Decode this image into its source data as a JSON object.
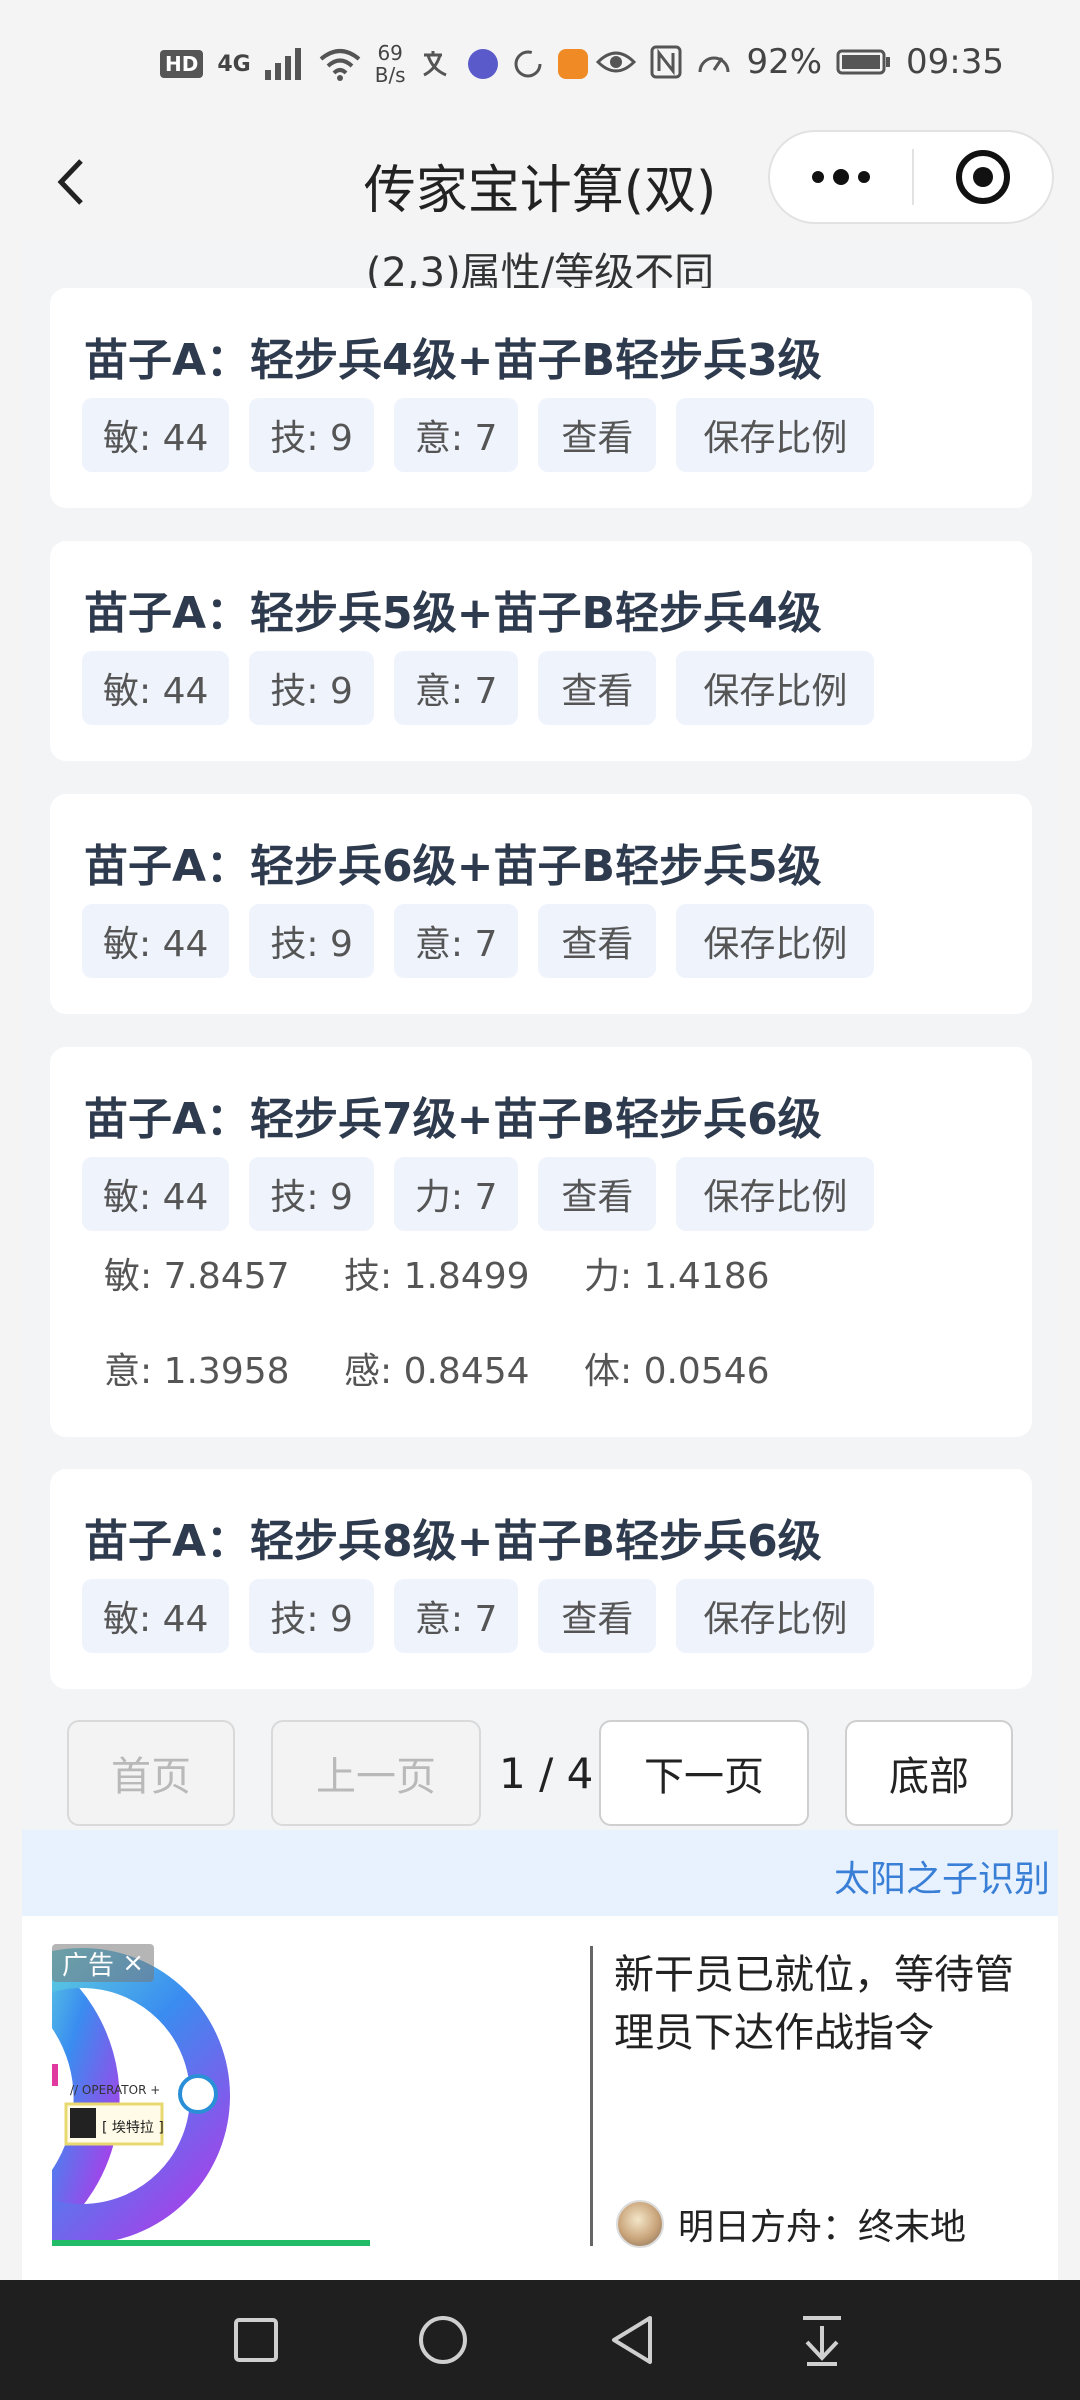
{
  "status_bar": {
    "hd": "HD",
    "network": "4G",
    "speed_value": "69",
    "speed_unit": "B/s",
    "battery": "92%",
    "time": "09:35"
  },
  "header": {
    "title": "传家宝计算(双)"
  },
  "subtitle": "(2,3)属性/等级不同",
  "cards": [
    {
      "title": "苗子A：轻步兵4级+苗子B轻步兵3级",
      "chips": [
        "敏: 44",
        "技: 9",
        "意: 7"
      ],
      "view_label": "查看",
      "save_label": "保存比例"
    },
    {
      "title": "苗子A：轻步兵5级+苗子B轻步兵4级",
      "chips": [
        "敏: 44",
        "技: 9",
        "意: 7"
      ],
      "view_label": "查看",
      "save_label": "保存比例"
    },
    {
      "title": "苗子A：轻步兵6级+苗子B轻步兵5级",
      "chips": [
        "敏: 44",
        "技: 9",
        "意: 7"
      ],
      "view_label": "查看",
      "save_label": "保存比例"
    },
    {
      "title": "苗子A：轻步兵7级+苗子B轻步兵6级",
      "chips": [
        "敏: 44",
        "技: 9",
        "力: 7"
      ],
      "view_label": "查看",
      "save_label": "保存比例",
      "ratios": [
        "敏: 7.8457",
        "技: 1.8499",
        "力: 1.4186",
        "意: 1.3958",
        "感: 0.8454",
        "体: 0.0546"
      ]
    },
    {
      "title": "苗子A：轻步兵8级+苗子B轻步兵6级",
      "chips": [
        "敏: 44",
        "技: 9",
        "意: 7"
      ],
      "view_label": "查看",
      "save_label": "保存比例"
    }
  ],
  "pagination": {
    "first": "首页",
    "prev": "上一页",
    "page_info": "1 / 4",
    "next": "下一页",
    "last": "底部"
  },
  "marquee_text": "太阳之子识别",
  "ad": {
    "tag": "广告",
    "headline": "新干员已就位，等待管理员下达作战指令",
    "source": "明日方舟：终末地",
    "image_text_operator": "// OPERATOR +",
    "image_text_name": "埃特拉"
  },
  "colors": {
    "accent_blue": "#5aa0ff",
    "chip_bg": "#eef3fc",
    "title_text": "#2e3a4d"
  }
}
